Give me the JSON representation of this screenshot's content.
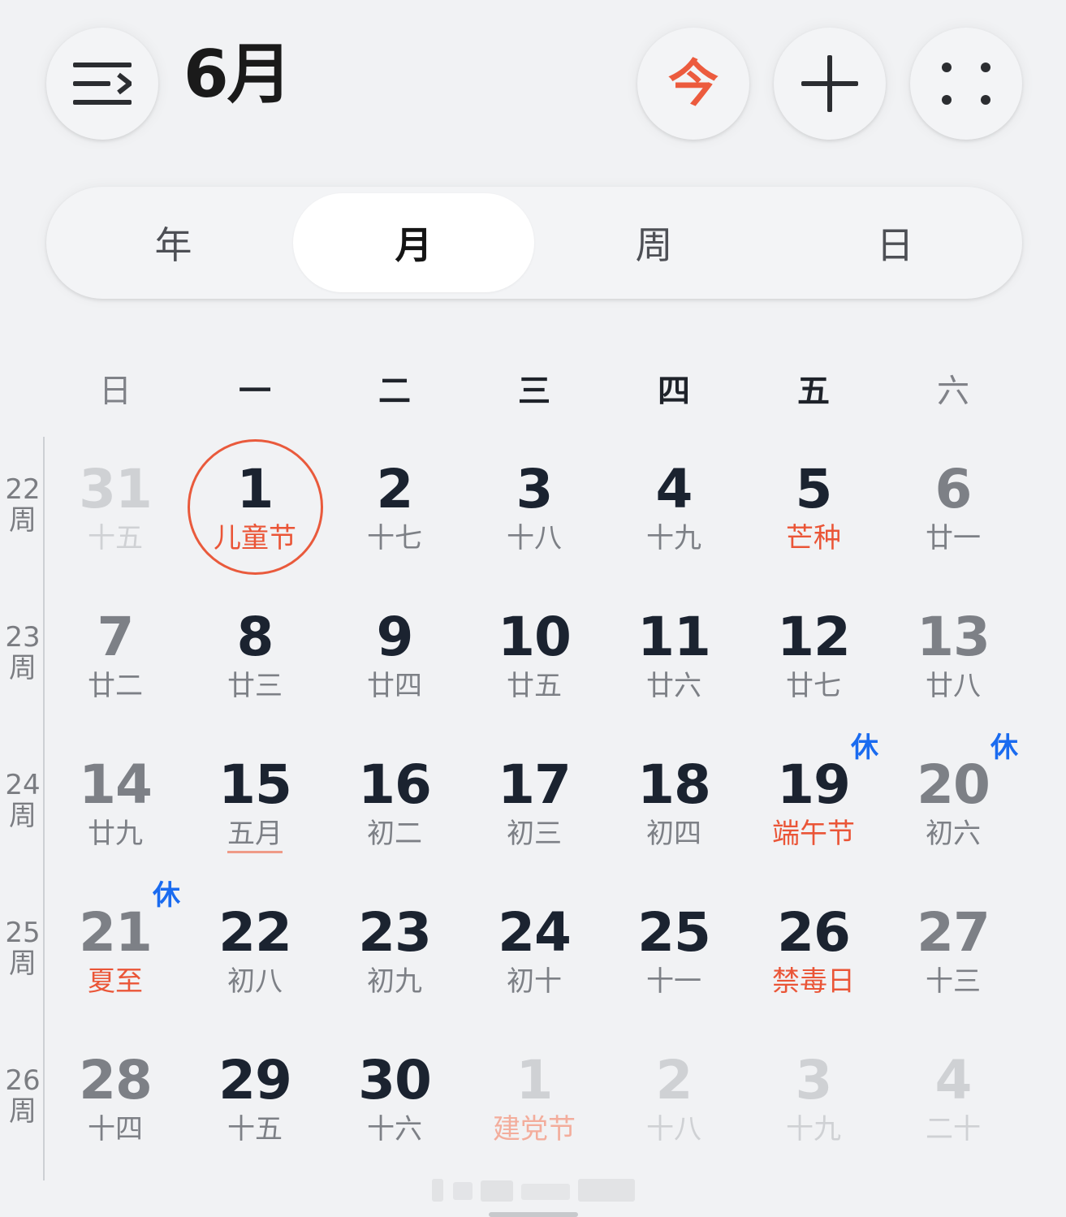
{
  "header": {
    "month_title": "6月",
    "today_label": "今"
  },
  "icons": {
    "menu": "menu-lines-icon",
    "add": "plus-icon",
    "more": "four-dots-icon"
  },
  "colors": {
    "accent": "#ea5537",
    "rest_badge": "#1a6bf0",
    "background": "#f1f2f4"
  },
  "view_tabs": [
    {
      "label": "年",
      "active": false
    },
    {
      "label": "月",
      "active": true
    },
    {
      "label": "周",
      "active": false
    },
    {
      "label": "日",
      "active": false
    }
  ],
  "weekdays": [
    "日",
    "一",
    "二",
    "三",
    "四",
    "五",
    "六"
  ],
  "weeks": [
    {
      "week_label": [
        "22",
        "周"
      ],
      "days": [
        {
          "num": "31",
          "lunar": "十五",
          "other_month": true
        },
        {
          "num": "1",
          "lunar": "儿童节",
          "festival": true,
          "today": true
        },
        {
          "num": "2",
          "lunar": "十七"
        },
        {
          "num": "3",
          "lunar": "十八"
        },
        {
          "num": "4",
          "lunar": "十九"
        },
        {
          "num": "5",
          "lunar": "芒种",
          "festival": true
        },
        {
          "num": "6",
          "lunar": "廿一"
        }
      ]
    },
    {
      "week_label": [
        "23",
        "周"
      ],
      "days": [
        {
          "num": "7",
          "lunar": "廿二"
        },
        {
          "num": "8",
          "lunar": "廿三"
        },
        {
          "num": "9",
          "lunar": "廿四"
        },
        {
          "num": "10",
          "lunar": "廿五"
        },
        {
          "num": "11",
          "lunar": "廿六"
        },
        {
          "num": "12",
          "lunar": "廿七"
        },
        {
          "num": "13",
          "lunar": "廿八"
        }
      ]
    },
    {
      "week_label": [
        "24",
        "周"
      ],
      "days": [
        {
          "num": "14",
          "lunar": "廿九"
        },
        {
          "num": "15",
          "lunar": "五月",
          "month_start": true
        },
        {
          "num": "16",
          "lunar": "初二"
        },
        {
          "num": "17",
          "lunar": "初三"
        },
        {
          "num": "18",
          "lunar": "初四"
        },
        {
          "num": "19",
          "lunar": "端午节",
          "festival": true,
          "badge": "休"
        },
        {
          "num": "20",
          "lunar": "初六",
          "badge": "休"
        }
      ]
    },
    {
      "week_label": [
        "25",
        "周"
      ],
      "days": [
        {
          "num": "21",
          "lunar": "夏至",
          "festival": true,
          "badge": "休"
        },
        {
          "num": "22",
          "lunar": "初八"
        },
        {
          "num": "23",
          "lunar": "初九"
        },
        {
          "num": "24",
          "lunar": "初十"
        },
        {
          "num": "25",
          "lunar": "十一"
        },
        {
          "num": "26",
          "lunar": "禁毒日",
          "festival": true
        },
        {
          "num": "27",
          "lunar": "十三"
        }
      ]
    },
    {
      "week_label": [
        "26",
        "周"
      ],
      "days": [
        {
          "num": "28",
          "lunar": "十四"
        },
        {
          "num": "29",
          "lunar": "十五"
        },
        {
          "num": "30",
          "lunar": "十六"
        },
        {
          "num": "1",
          "lunar": "建党节",
          "festival": true,
          "other_month": true
        },
        {
          "num": "2",
          "lunar": "十八",
          "other_month": true
        },
        {
          "num": "3",
          "lunar": "十九",
          "other_month": true
        },
        {
          "num": "4",
          "lunar": "二十",
          "other_month": true
        }
      ]
    }
  ]
}
